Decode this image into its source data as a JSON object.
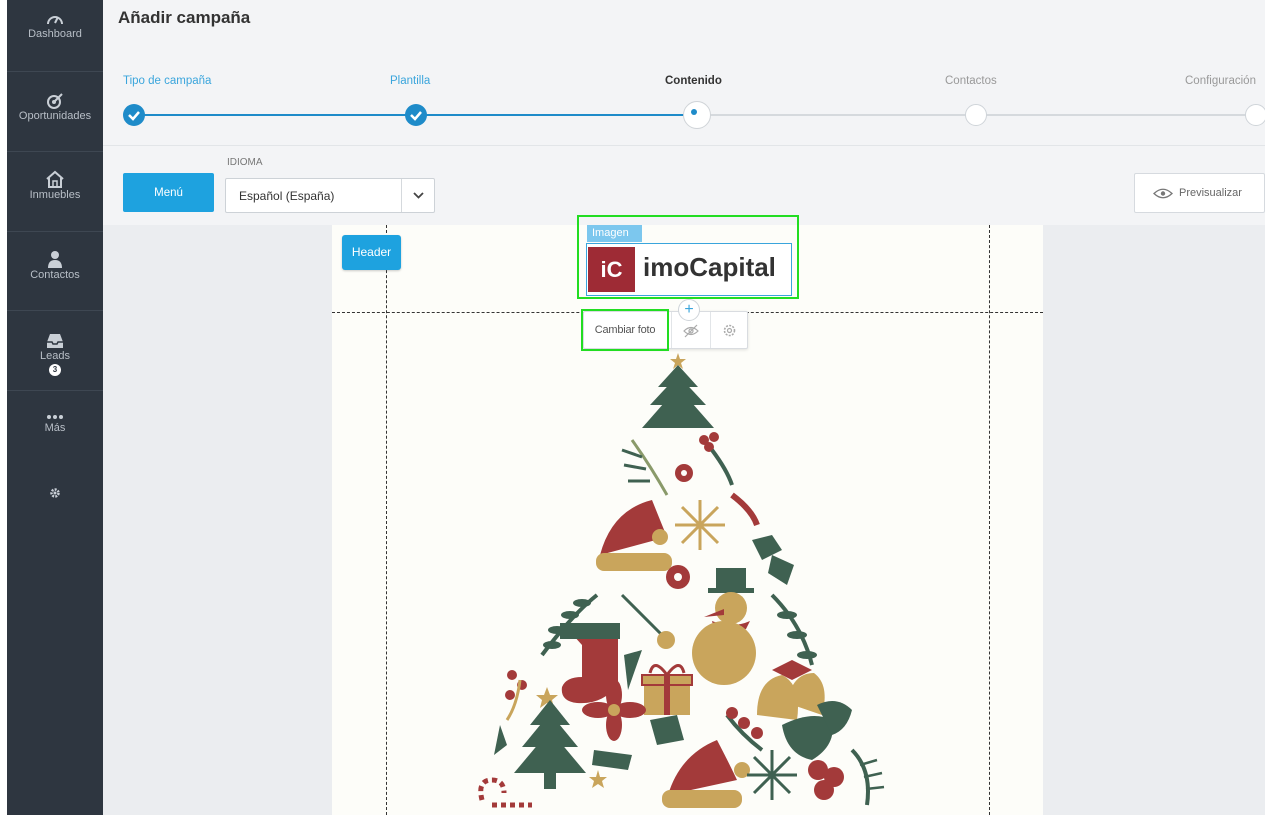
{
  "sidebar": {
    "items": [
      {
        "label": "Dashboard",
        "icon": "gauge-icon"
      },
      {
        "label": "Oportunidades",
        "icon": "target-icon"
      },
      {
        "label": "Inmuebles",
        "icon": "home-icon"
      },
      {
        "label": "Contactos",
        "icon": "user-icon"
      },
      {
        "label": "Leads",
        "icon": "inbox-icon",
        "badge": "3"
      },
      {
        "label": "Más",
        "icon": "more-icon"
      },
      {
        "label": "",
        "icon": "gear-icon"
      }
    ]
  },
  "page": {
    "title": "Añadir campaña"
  },
  "stepper": {
    "steps": [
      {
        "label": "Tipo de campaña",
        "state": "done"
      },
      {
        "label": "Plantilla",
        "state": "done"
      },
      {
        "label": "Contenido",
        "state": "active"
      },
      {
        "label": "Contactos",
        "state": "todo"
      },
      {
        "label": "Configuración",
        "state": "todo"
      }
    ]
  },
  "toolbar": {
    "menu_label": "Menú",
    "idioma_label": "IDIOMA",
    "language_value": "Español (España)",
    "preview_label": "Previsualizar"
  },
  "editor": {
    "header_tag": "Header",
    "image_tag": "Imagen",
    "logo_mark": "iC",
    "logo_text": "imoCapital",
    "plus": "+",
    "change_photo": "Cambiar foto"
  },
  "colors": {
    "accent": "#1ea2df",
    "sidebar_bg": "#2e3640",
    "highlight": "#22dd22",
    "brand": "#9e2b35",
    "tree_green": "#3f6151",
    "tree_red": "#a33a3a",
    "tree_gold": "#c9a55c"
  }
}
